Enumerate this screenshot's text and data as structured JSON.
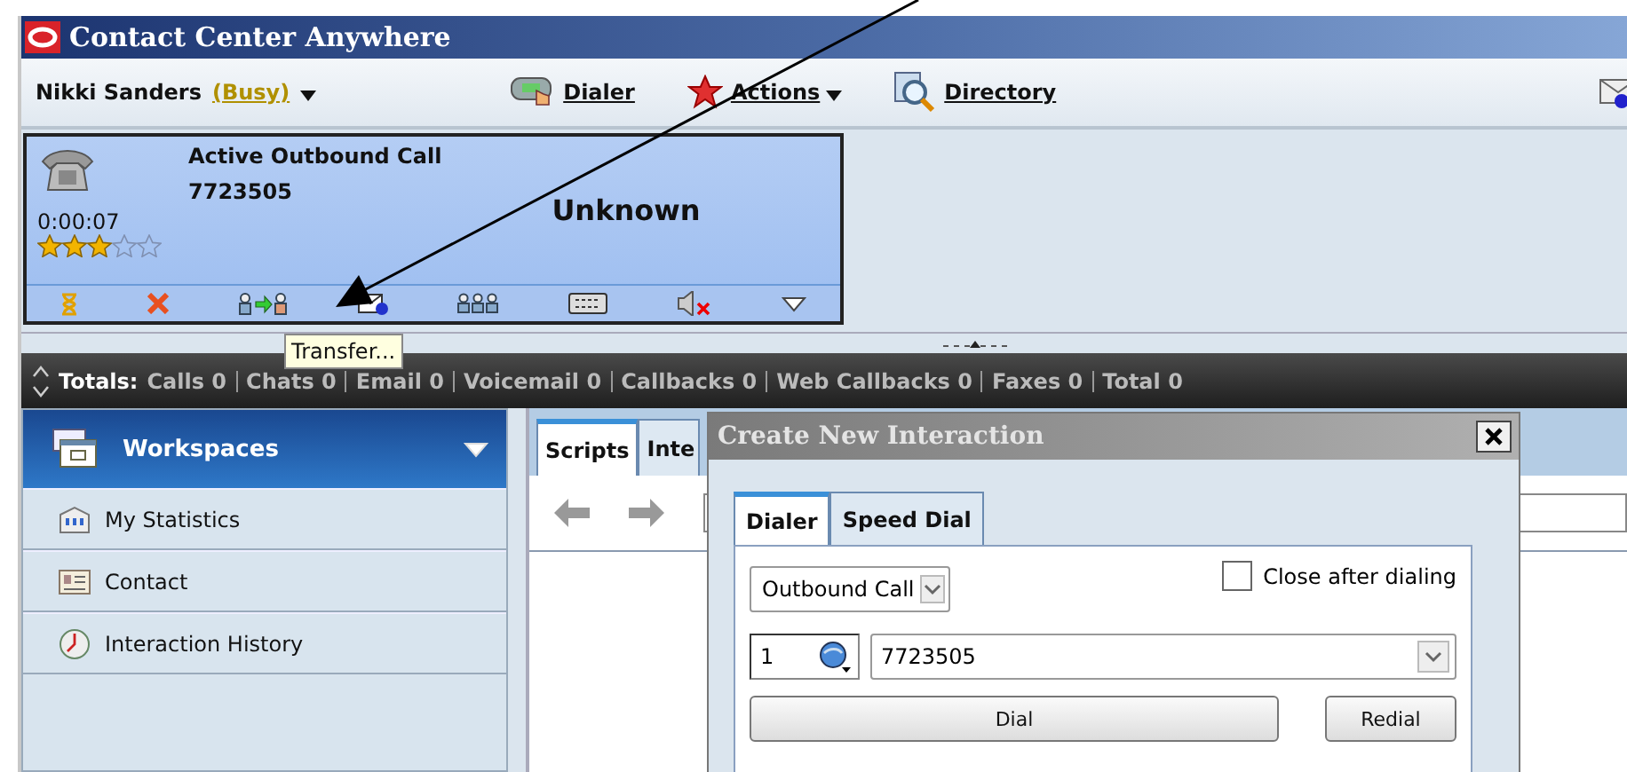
{
  "window": {
    "title": "Contact Center Anywhere"
  },
  "toolbar": {
    "agent_name": "Nikki Sanders",
    "status": "(Busy)",
    "dialer": "Dialer",
    "actions": "Actions",
    "directory": "Directory"
  },
  "call": {
    "title": "Active Outbound Call",
    "number": "7723505",
    "contact": "Unknown",
    "timer": "0:00:07",
    "stars": 3
  },
  "tooltip": "Transfer...",
  "totals": {
    "label": "Totals:",
    "items": [
      "Calls 0",
      "Chats 0",
      "Email 0",
      "Voicemail 0",
      "Callbacks 0",
      "Web Callbacks 0",
      "Faxes 0",
      "Total 0"
    ]
  },
  "sidebar": {
    "title": "Workspaces",
    "items": [
      {
        "label": "My Statistics"
      },
      {
        "label": "Contact"
      },
      {
        "label": "Interaction History"
      }
    ]
  },
  "content": {
    "tabs": [
      {
        "label": "Scripts",
        "selected": true
      },
      {
        "label": "Inte",
        "selected": false
      }
    ]
  },
  "dialog": {
    "title": "Create New Interaction",
    "tabs": [
      {
        "label": "Dialer",
        "selected": true
      },
      {
        "label": "Speed Dial",
        "selected": false
      }
    ],
    "type": "Outbound Call",
    "close_after": {
      "label": "Close after dialing",
      "checked": false
    },
    "country_code": "1",
    "number": "7723505",
    "buttons": [
      "Dial",
      "Redial"
    ]
  }
}
